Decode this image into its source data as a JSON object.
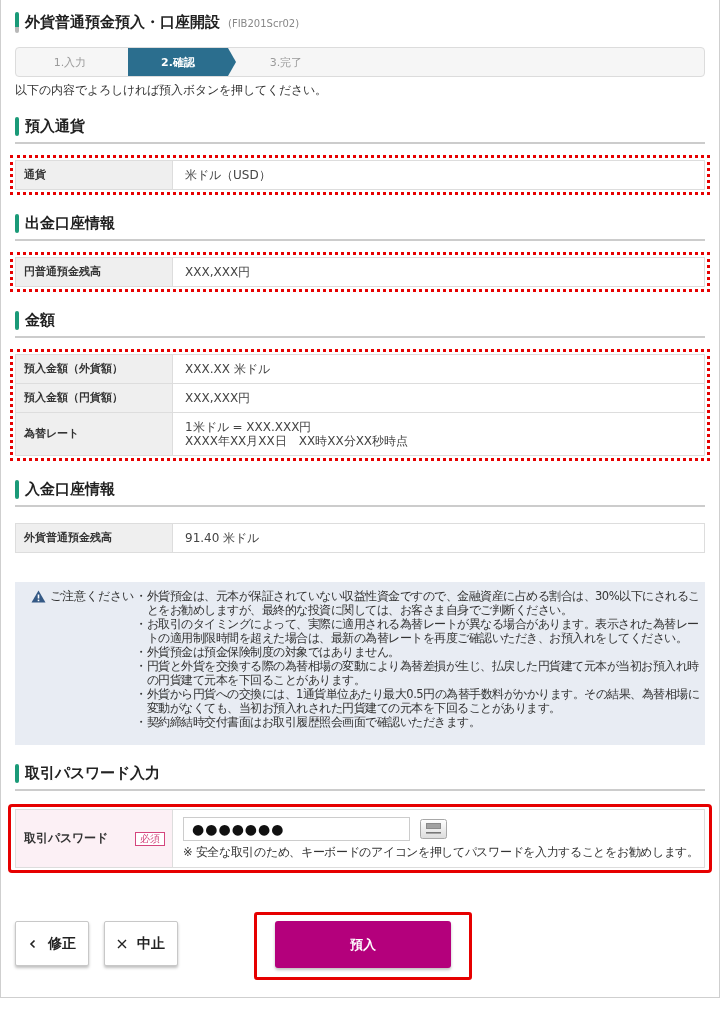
{
  "page": {
    "title": "外貨普通預金預入・口座開設",
    "screen_id": "(FIB201Scr02)"
  },
  "steps": [
    {
      "label": "1.入力",
      "selected": false
    },
    {
      "label": "2.確認",
      "selected": true
    },
    {
      "label": "3.完了",
      "selected": false
    }
  ],
  "instruction": "以下の内容でよろしければ預入ボタンを押してください。",
  "sections": [
    {
      "heading": "預入通貨",
      "highlighted": true,
      "rows": [
        {
          "label": "通貨",
          "lines": [
            "米ドル（USD）"
          ]
        }
      ]
    },
    {
      "heading": "出金口座情報",
      "highlighted": true,
      "rows": [
        {
          "label": "円普通預金残高",
          "lines": [
            "XXX,XXX円"
          ]
        }
      ]
    },
    {
      "heading": "金額",
      "highlighted": true,
      "rows": [
        {
          "label": "預入金額（外貨額）",
          "lines": [
            "XXX.XX 米ドル"
          ]
        },
        {
          "label": "預入金額（円貨額）",
          "lines": [
            "XXX,XXX円"
          ]
        },
        {
          "label": "為替レート",
          "lines": [
            "1米ドル = XXX.XXX円",
            "XXXX年XX月XX日　XX時XX分XX秒時点"
          ]
        }
      ]
    },
    {
      "heading": "入金口座情報",
      "highlighted": false,
      "rows": [
        {
          "label": "外貨普通預金残高",
          "lines": [
            "91.40 米ドル"
          ]
        }
      ]
    }
  ],
  "notice": {
    "title": "ご注意ください",
    "items": [
      "・外貨預金は、元本が保証されていない収益性資金ですので、金融資産に占める割合は、30%以下にされることをお勧めしますが、最終的な投資に関しては、お客さま自身でご判断ください。",
      "・お取引のタイミングによって、実際に適用される為替レートが異なる場合があります。表示された為替レートの適用制限時間を超えた場合は、最新の為替レートを再度ご確認いただき、お預入れをしてください。",
      "・外貨預金は預金保険制度の対象ではありません。",
      "・円貨と外貨を交換する際の為替相場の変動により為替差損が生じ、払戻した円貨建て元本が当初お預入れ時の円貨建て元本を下回ることがあります。",
      "・外貨から円貨への交換には、1通貨単位あたり最大0.5円の為替手数料がかかります。その結果、為替相場に変動がなくても、当初お預入れされた円貨建ての元本を下回ることがあります。",
      "・契約締結時交付書面はお取引履歴照会画面で確認いただきます。"
    ]
  },
  "password_section": {
    "heading": "取引パスワード入力",
    "highlighted": true,
    "label": "取引パスワード",
    "badge": "必須",
    "value": "●●●●●●●",
    "note": "※ 安全な取引のため、キーボードのアイコンを押してパスワードを入力することをお勧めします。"
  },
  "buttons": [
    {
      "label": "修正",
      "kind": "back"
    },
    {
      "label": "中止",
      "kind": "cancel"
    },
    {
      "label": "預入",
      "kind": "primary",
      "highlighted": true
    }
  ]
}
